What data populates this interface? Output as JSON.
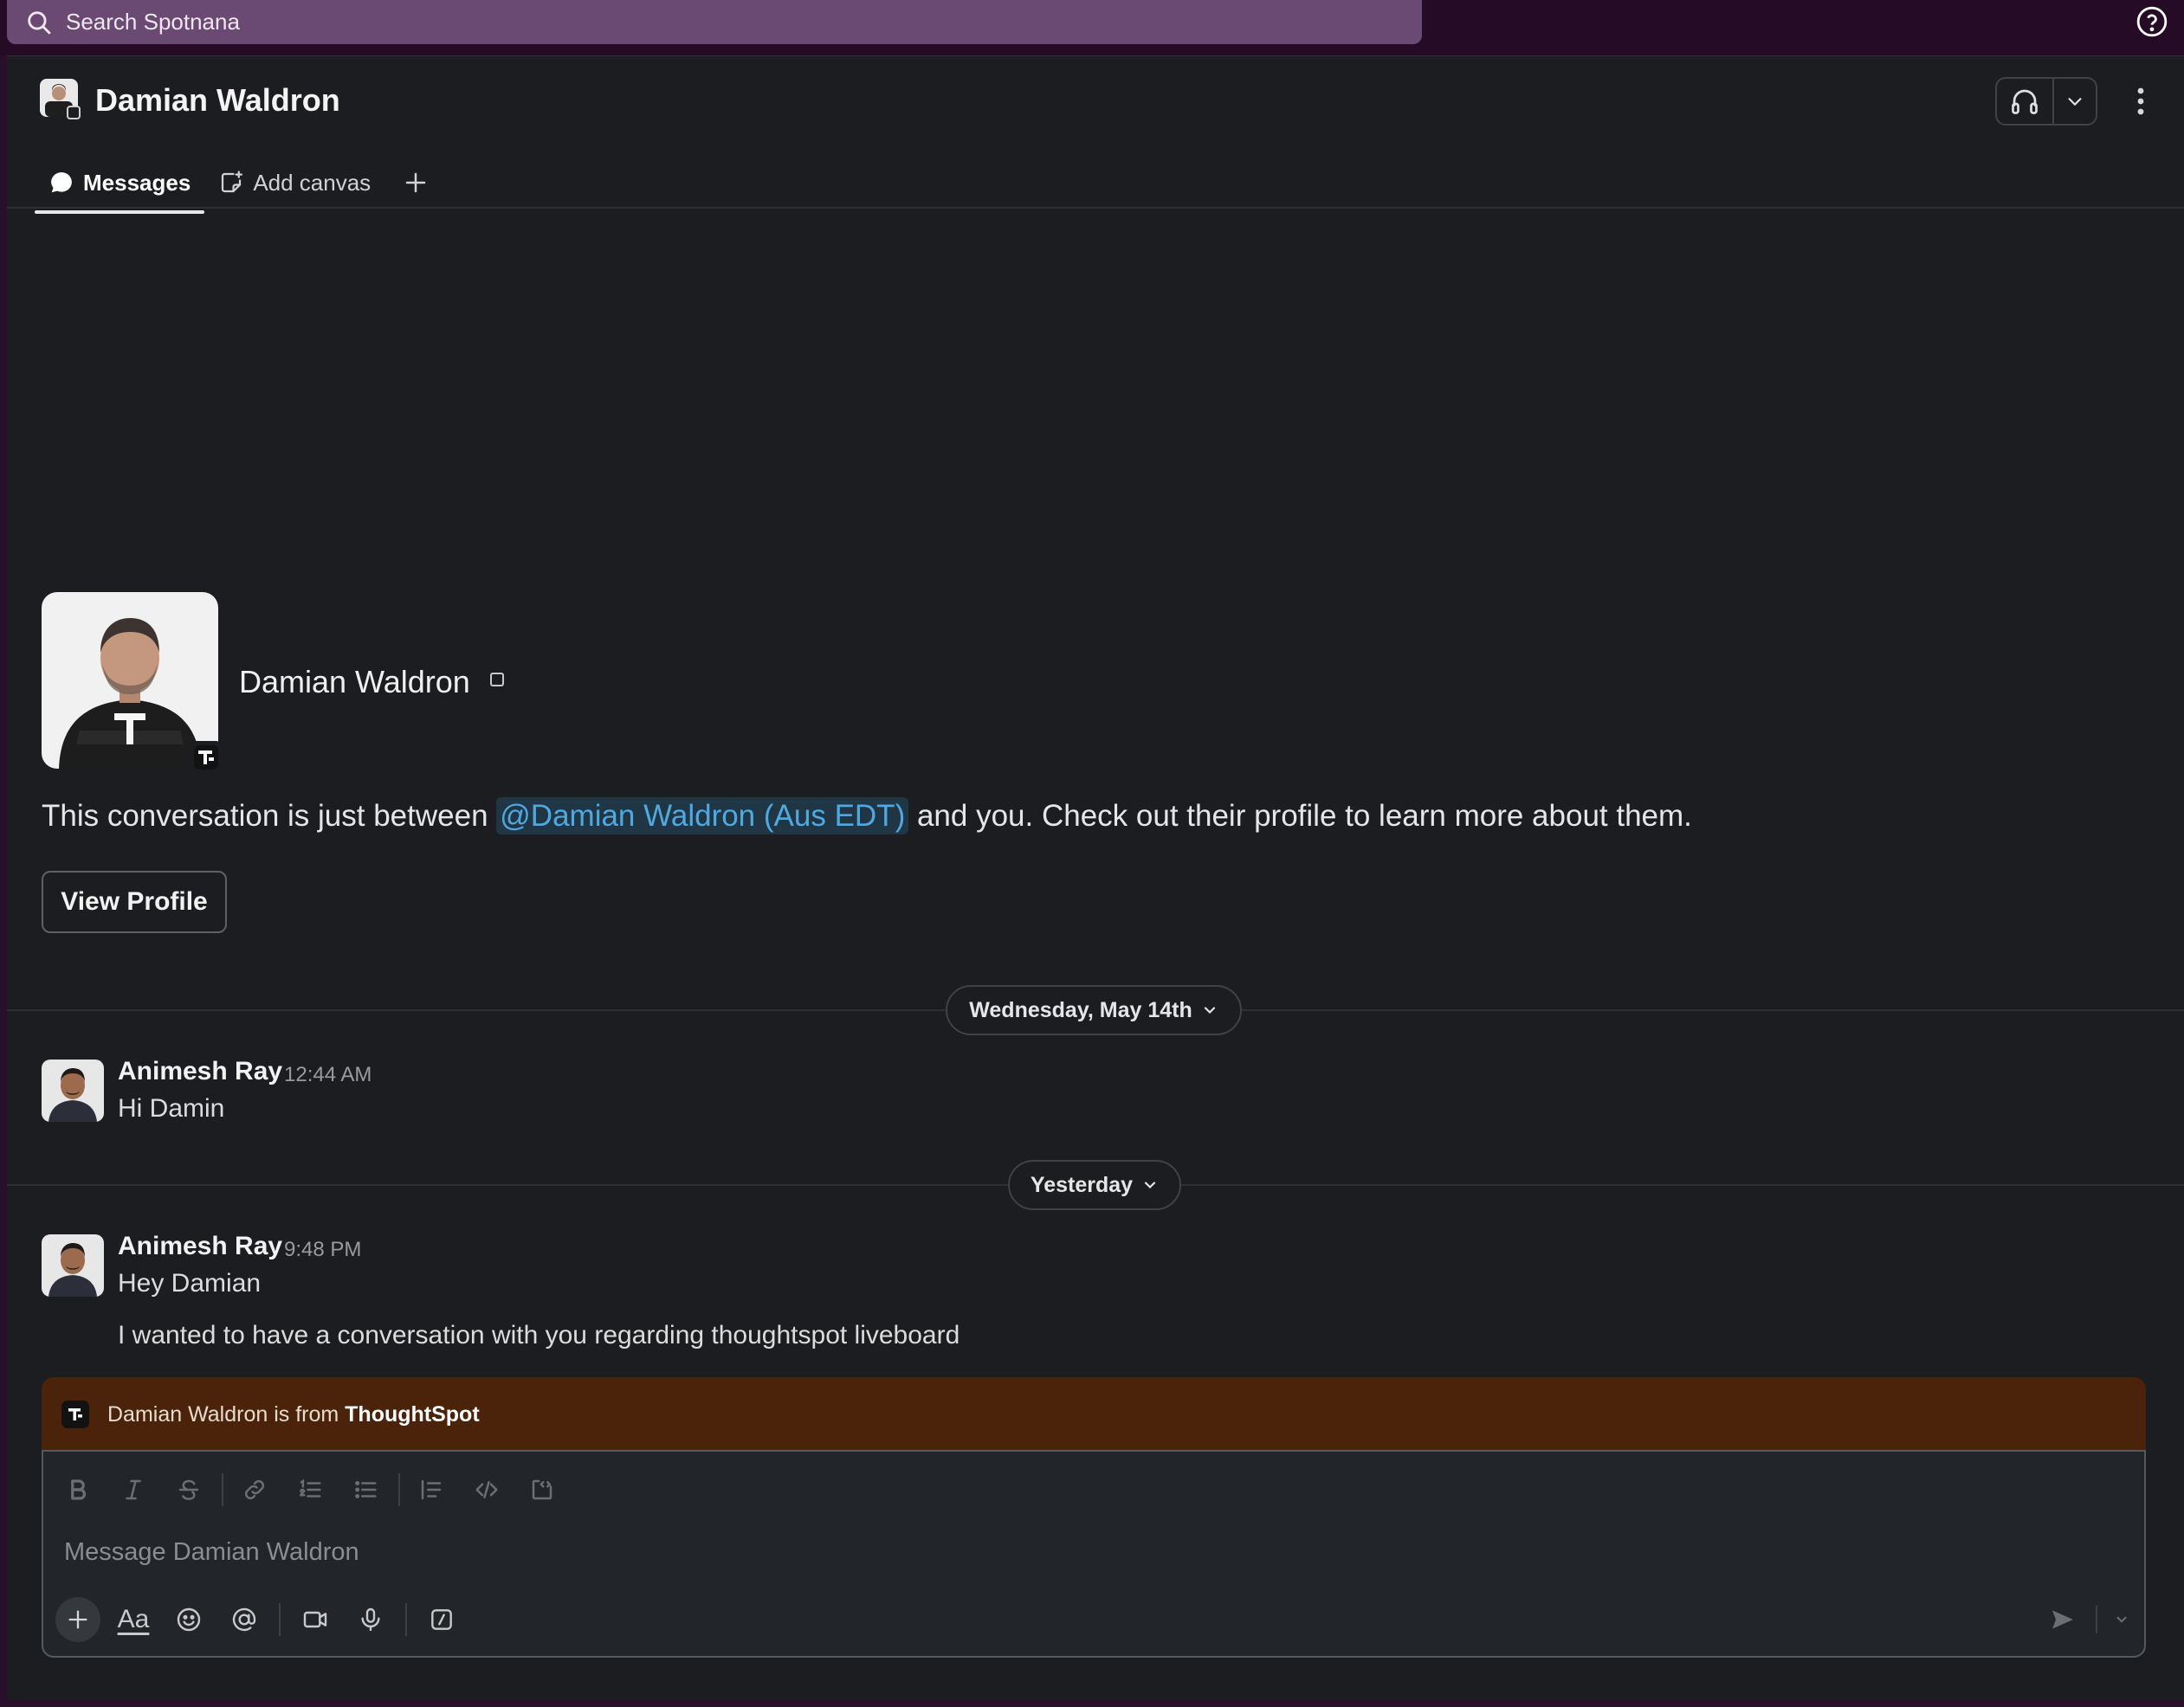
{
  "search": {
    "placeholder": "Search Spotnana"
  },
  "header": {
    "title": "Damian Waldron"
  },
  "tabs": [
    {
      "label": "Messages"
    },
    {
      "label": "Add canvas"
    }
  ],
  "intro": {
    "name": "Damian Waldron",
    "text_before": "This conversation is just between ",
    "mention": "@Damian Waldron (Aus EDT)",
    "text_after": " and you. Check out their profile to learn more about them.",
    "button_label": "View Profile"
  },
  "dividers": [
    {
      "label": "Wednesday, May 14th"
    },
    {
      "label": "Yesterday"
    }
  ],
  "messages": [
    {
      "author": "Animesh Ray",
      "time": "12:44 AM",
      "lines": [
        "Hi Damin"
      ]
    },
    {
      "author": "Animesh Ray",
      "time": "9:48 PM",
      "lines": [
        "Hey Damian",
        "I wanted to have a conversation with you regarding thoughtspot liveboard"
      ]
    }
  ],
  "banner": {
    "text": "Damian Waldron is from ",
    "org": "ThoughtSpot"
  },
  "composer": {
    "placeholder": "Message Damian Waldron",
    "format_label": "Aa"
  },
  "colors": {
    "top_bar": "#250b26",
    "search_bg": "#6a4a72",
    "panel_bg": "#1b1d21",
    "mention": "#4fa9e0",
    "banner_bg": "#4a230a"
  },
  "icons": [
    "search-icon",
    "help-icon",
    "headphones-icon",
    "chevron-down-icon",
    "more-vertical-icon",
    "message-bubble-icon",
    "canvas-icon",
    "plus-icon",
    "thoughtspot-icon",
    "bold-icon",
    "italic-icon",
    "strikethrough-icon",
    "link-icon",
    "ordered-list-icon",
    "bulleted-list-icon",
    "blockquote-icon",
    "code-icon",
    "code-block-icon",
    "emoji-icon",
    "mention-icon",
    "video-icon",
    "microphone-icon",
    "slash-command-icon",
    "send-icon"
  ]
}
